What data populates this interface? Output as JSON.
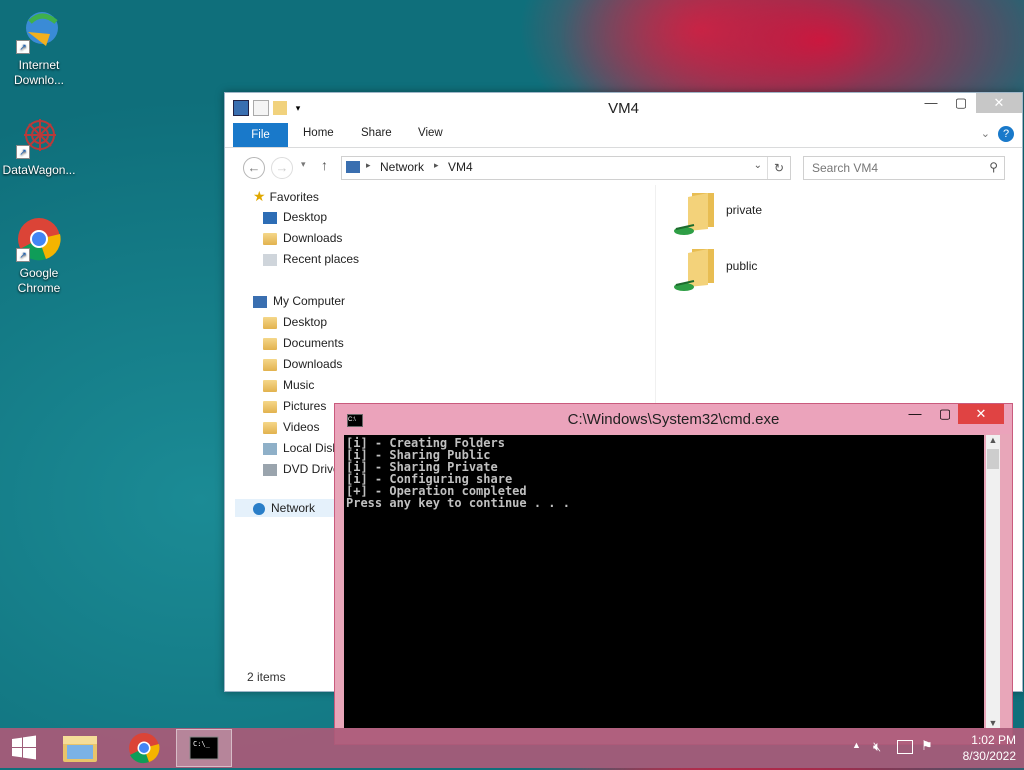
{
  "desktop": {
    "icons": [
      {
        "label": "Internet Downlo..."
      },
      {
        "label": "DataWagon..."
      },
      {
        "label": "Google Chrome"
      }
    ]
  },
  "explorer": {
    "title": "VM4",
    "ribbon": {
      "file": "File",
      "home": "Home",
      "share": "Share",
      "view": "View"
    },
    "address": {
      "crumbs": [
        "Network",
        "VM4"
      ]
    },
    "search_placeholder": "Search VM4",
    "nav": {
      "favorites": "Favorites",
      "fav_items": [
        "Desktop",
        "Downloads",
        "Recent places"
      ],
      "computer": "My Computer",
      "computer_items": [
        "Desktop",
        "Documents",
        "Downloads",
        "Music",
        "Pictures",
        "Videos",
        "Local Disk",
        "DVD Drive"
      ],
      "network": "Network"
    },
    "files": [
      {
        "name": "private"
      },
      {
        "name": "public"
      }
    ],
    "status": "2 items"
  },
  "cmd": {
    "title": "C:\\Windows\\System32\\cmd.exe",
    "lines": [
      "[i] - Creating Folders",
      "[i] - Sharing Public",
      "[i] - Sharing Private",
      "[i] - Configuring share",
      "[+] - Operation completed",
      "Press any key to continue . . ."
    ]
  },
  "taskbar": {
    "time": "1:02 PM",
    "date": "8/30/2022"
  }
}
